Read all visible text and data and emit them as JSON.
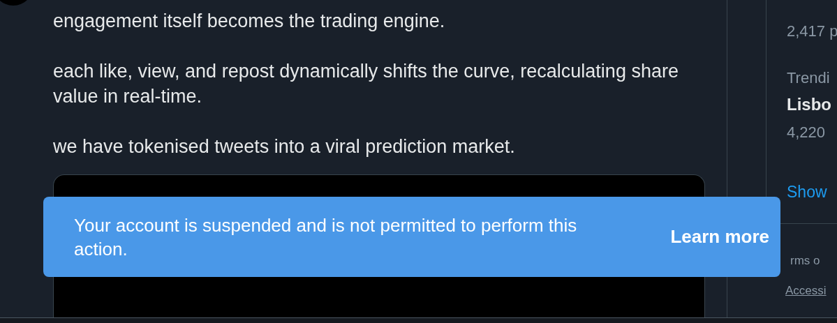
{
  "post": {
    "paragraphs": [
      [
        "engagement itself becomes the trading engine."
      ],
      [
        "each like, view, and repost dynamically shifts the curve, recalculating share",
        "value in real-time."
      ],
      [
        "we have tokenised tweets into a viral prediction market."
      ]
    ]
  },
  "toast": {
    "message": "Your account is suspended and is not permitted to perform this action.",
    "action": "Learn more"
  },
  "sidebar": {
    "trends": [
      {
        "meta": "2,417 p"
      },
      {
        "context": "Trendi",
        "title": "Lisbo",
        "meta": "4,220"
      }
    ],
    "show_more": "Show",
    "footer_links": [
      "rms o",
      "Accessi"
    ]
  }
}
